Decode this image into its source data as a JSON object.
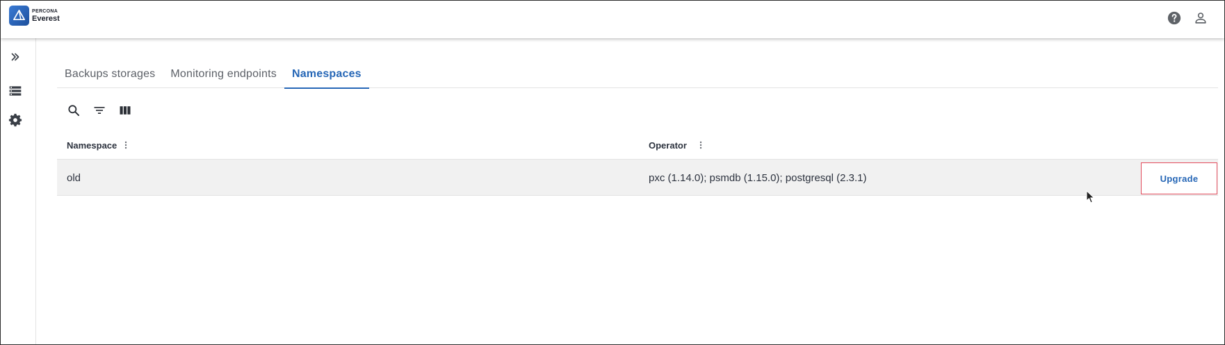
{
  "app": {
    "brand": "PERCONA",
    "product": "Everest"
  },
  "header": {
    "icons": [
      "help-icon",
      "account-icon"
    ]
  },
  "sidebar": {
    "icons": [
      "expand-double-chevron-icon",
      "databases-list-icon",
      "settings-gear-icon"
    ]
  },
  "tabs": [
    {
      "label": "Backups storages",
      "active": false
    },
    {
      "label": "Monitoring endpoints",
      "active": false
    },
    {
      "label": "Namespaces",
      "active": true
    }
  ],
  "toolbar": {
    "icons": [
      "search-icon",
      "filter-icon",
      "columns-icon"
    ]
  },
  "table": {
    "columns": [
      {
        "label": "Namespace"
      },
      {
        "label": "Operator"
      }
    ],
    "rows": [
      {
        "namespace": "old",
        "operator": "pxc (1.14.0); psmdb (1.15.0); postgresql (2.3.1)",
        "action": "Upgrade"
      }
    ]
  },
  "colors": {
    "accent": "#2566b6",
    "highlight_border": "#e34b5c",
    "row_background": "#f1f1f1"
  }
}
